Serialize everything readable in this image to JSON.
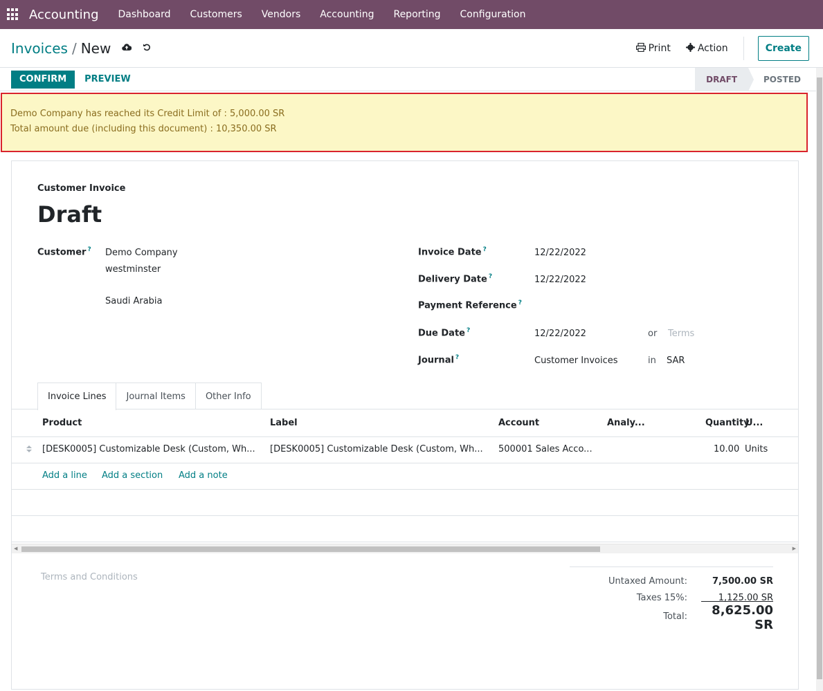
{
  "navbar": {
    "app_name": "Accounting",
    "items": [
      "Dashboard",
      "Customers",
      "Vendors",
      "Accounting",
      "Reporting",
      "Configuration"
    ]
  },
  "control": {
    "breadcrumb_parent": "Invoices",
    "breadcrumb_separator": "/",
    "breadcrumb_current": "New",
    "print_label": "Print",
    "action_label": "Action",
    "create_label": "Create"
  },
  "statusbar": {
    "confirm_label": "CONFIRM",
    "preview_label": "PREVIEW",
    "stages": [
      "DRAFT",
      "POSTED"
    ]
  },
  "alert": {
    "line1": "Demo Company has reached its Credit Limit of : 5,000.00 SR",
    "line2": "Total amount due (including this document) : 10,350.00 SR"
  },
  "form": {
    "type_label": "Customer Invoice",
    "title": "Draft",
    "customer_label": "Customer",
    "customer_name": "Demo Company",
    "customer_address1": "westminster",
    "customer_country": "Saudi Arabia",
    "invoice_date_label": "Invoice Date",
    "invoice_date": "12/22/2022",
    "delivery_date_label": "Delivery Date",
    "delivery_date": "12/22/2022",
    "payment_ref_label": "Payment Reference",
    "due_date_label": "Due Date",
    "due_date": "12/22/2022",
    "or_label": "or",
    "terms_placeholder": "Terms",
    "journal_label": "Journal",
    "journal": "Customer Invoices",
    "in_label": "in",
    "currency": "SAR",
    "help_mark": "?"
  },
  "tabs": [
    "Invoice Lines",
    "Journal Items",
    "Other Info"
  ],
  "table": {
    "columns": [
      "Product",
      "Label",
      "Account",
      "Analy...",
      "Quantity",
      "U..."
    ],
    "rows": [
      {
        "product": "[DESK0005] Customizable Desk (Custom, Wh...",
        "label": "[DESK0005] Customizable Desk (Custom, Wh...",
        "account": "500001 Sales Acco...",
        "analytic": "",
        "quantity": "10.00",
        "uom": "Units"
      }
    ],
    "add_line": "Add a line",
    "add_section": "Add a section",
    "add_note": "Add a note"
  },
  "footer": {
    "terms_placeholder": "Terms and Conditions",
    "untaxed_label": "Untaxed Amount:",
    "untaxed_value": "7,500.00 SR",
    "taxes_label": "Taxes 15%:",
    "taxes_value": "1,125.00 SR",
    "total_label": "Total:",
    "total_value": "8,625.00 SR"
  }
}
